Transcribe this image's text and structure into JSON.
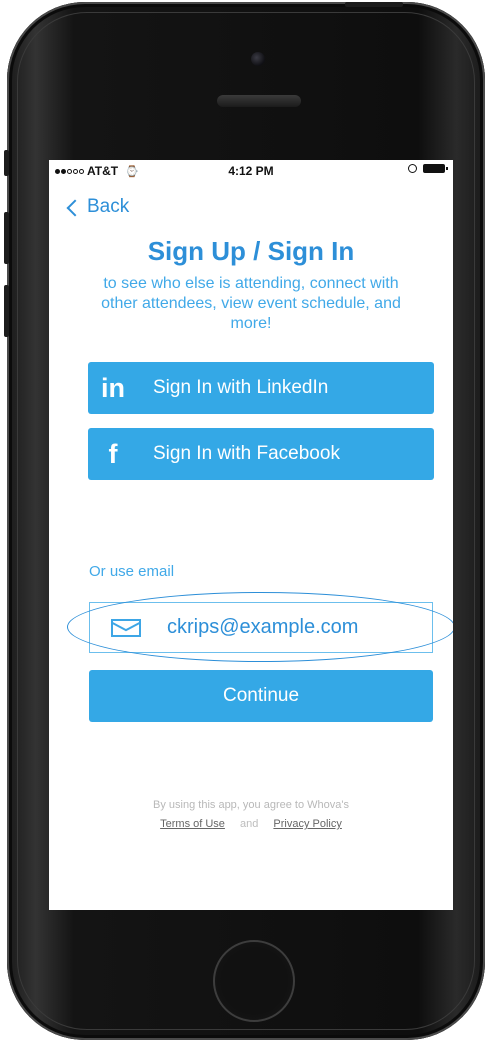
{
  "status_bar": {
    "carrier": "AT&T",
    "time": "4:12 PM"
  },
  "icons": {
    "wifi": "wifi-icon",
    "lock": "rotation-lock-icon",
    "battery": "battery-icon",
    "back": "chevron-left-icon",
    "linkedin": "linkedin-icon",
    "facebook": "facebook-icon",
    "email": "envelope-icon"
  },
  "nav": {
    "back_label": "Back"
  },
  "header": {
    "title": "Sign Up / Sign In",
    "subtitle": "to see who else is attending, connect with other attendees, view event schedule, and more!"
  },
  "social": {
    "linkedin_glyph": "in",
    "linkedin_label": "Sign In with LinkedIn",
    "facebook_glyph": "f",
    "facebook_label": "Sign In with Facebook"
  },
  "email": {
    "or_label": "Or use email",
    "value": "ckrips@example.com",
    "continue_label": "Continue"
  },
  "legal": {
    "text": "By using this app, you agree to Whova's",
    "terms": "Terms of Use",
    "and": "and",
    "privacy": "Privacy Policy"
  },
  "colors": {
    "accent": "#34a8e6",
    "title": "#2d8fd8"
  }
}
